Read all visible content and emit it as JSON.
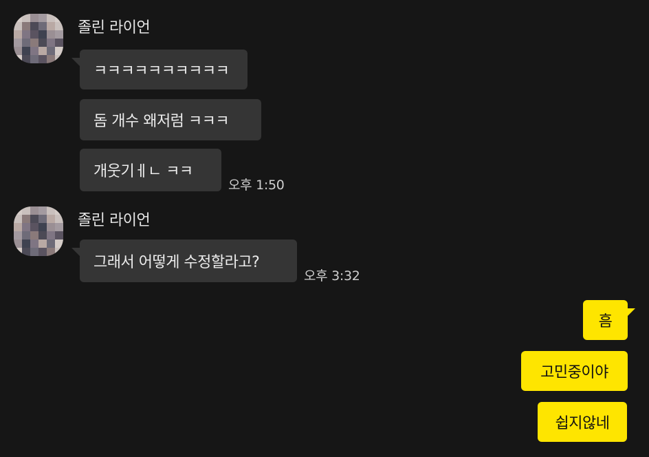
{
  "colors": {
    "background": "#161616",
    "incoming_bubble": "#353535",
    "outgoing_bubble": "#fee500",
    "sender_text": "#e6e6e6",
    "time_text": "#cfcfcf"
  },
  "groups": [
    {
      "sender": "졸린 라이언",
      "avatar_icon": "pixelated-avatar-icon",
      "messages": [
        "ㅋㅋㅋㅋㅋㅋㅋㅋㅋㅋ",
        "돔 개수 왜저럼 ㅋㅋㅋ",
        "개웃기ㅔㄴ ㅋㅋ"
      ],
      "time": "오후 1:50"
    },
    {
      "sender": "졸린 라이언",
      "avatar_icon": "pixelated-avatar-icon",
      "messages": [
        "그래서 어떻게 수정할라고?"
      ],
      "time": "오후 3:32"
    }
  ],
  "outgoing": {
    "messages": [
      "흠",
      "고민중이야",
      "쉽지않네"
    ]
  }
}
